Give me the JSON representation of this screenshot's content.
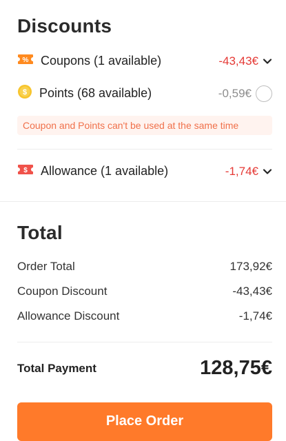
{
  "discounts": {
    "title": "Discounts",
    "coupons": {
      "label": "Coupons (1 available)",
      "value": "-43,43€",
      "icon": "coupon-percent-icon"
    },
    "points": {
      "label": "Points (68 available)",
      "value": "-0,59€",
      "icon": "dollar-coin-icon"
    },
    "notice": "Coupon and Points can't be used at the same time",
    "allowance": {
      "label": "Allowance (1 available)",
      "value": "-1,74€",
      "icon": "allowance-ticket-icon"
    },
    "chevron_icon": "chevron-down-icon"
  },
  "total": {
    "title": "Total",
    "lines": [
      {
        "label": "Order Total",
        "value": "173,92€"
      },
      {
        "label": "Coupon Discount",
        "value": "-43,43€"
      },
      {
        "label": "Allowance Discount",
        "value": "-1,74€"
      }
    ],
    "payment_label": "Total Payment",
    "payment_value": "128,75€"
  },
  "action": {
    "place_order_label": "Place Order"
  },
  "colors": {
    "accent_orange": "#ff7a2a",
    "discount_red": "#e53935",
    "notice_bg": "#fff3ef",
    "notice_text": "#f0704a",
    "coin_yellow": "#f7c42c"
  }
}
